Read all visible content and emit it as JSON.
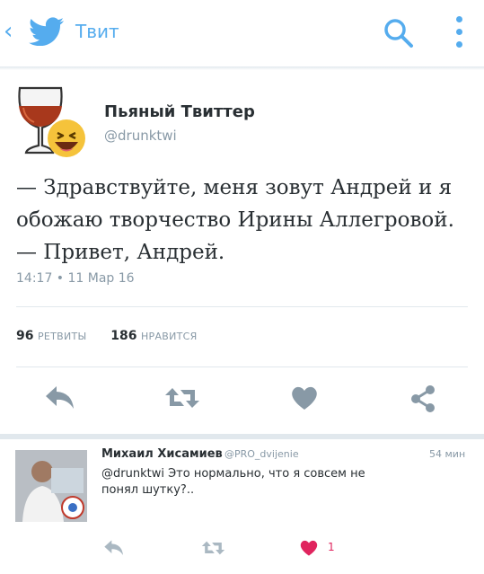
{
  "header": {
    "back_glyph": "‹",
    "title": "Твит",
    "accent_color": "#55acee",
    "icons": [
      "back-chevron-icon",
      "twitter-bird-icon",
      "search-icon",
      "more-vertical-icon"
    ]
  },
  "tweet": {
    "display_name": "Пьяный Твиттер",
    "handle": "@drunktwi",
    "avatar_icon": "brandy-glass-laughing-emoji-icon",
    "text_line1": "— Здравствуйте, меня зовут Андрей и я",
    "text_line2": "обожаю творчество Ирины Аллегровой.",
    "text_line3": "— Привет, Андрей.",
    "timestamp": "14:17 • 11 Мар 16",
    "retweets_count": "96",
    "retweets_label": "РЕТВИТЫ",
    "likes_count": "186",
    "likes_label": "НРАВИТСЯ",
    "action_icons": [
      "reply-icon",
      "retweet-icon",
      "heart-icon",
      "share-icon"
    ],
    "action_color": "#8899a6"
  },
  "reply": {
    "name": "Михаил Хисамиев",
    "handle": "@PRO_dvijenie",
    "time": "54 мин",
    "text": "@drunktwi Это нормально, что я совсем не понял шутку?..",
    "like_count": "1",
    "like_color": "#e0245e",
    "action_icons": [
      "reply-icon",
      "retweet-icon",
      "heart-filled-icon"
    ]
  }
}
